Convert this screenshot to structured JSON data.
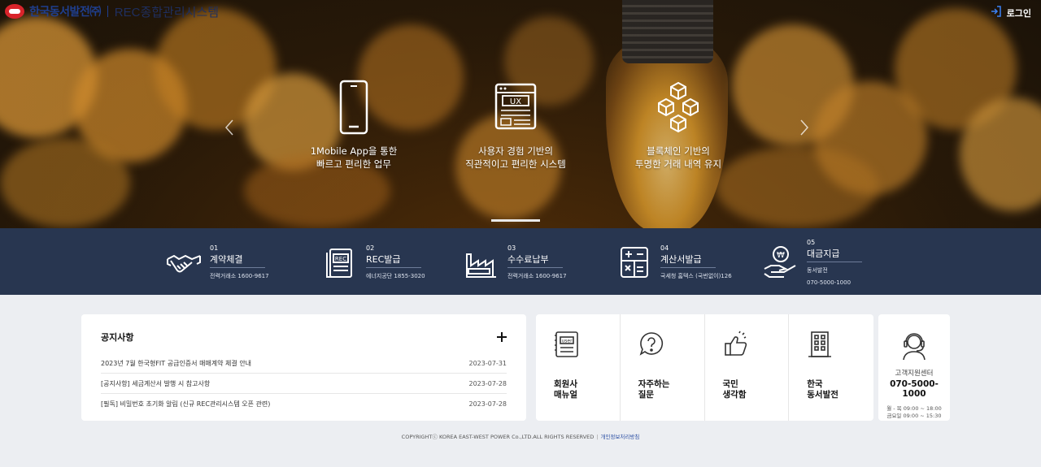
{
  "header": {
    "company": "한국동서발전㈜",
    "system": "REC종합관리시스템",
    "login_label": "로그인"
  },
  "hero": {
    "features": [
      {
        "icon": "smartphone-icon",
        "text": "1Mobile App을 통한\n빠르고 편리한 업무"
      },
      {
        "icon": "ux-document-icon",
        "text": "사용자 경험 기반의\n직관적이고 편리한 시스템"
      },
      {
        "icon": "blockchain-cubes-icon",
        "text": "블록체인 기반의\n투명한 거래 내역 유지"
      }
    ]
  },
  "services": [
    {
      "num": "01",
      "title": "계약체결",
      "sub": "전력거래소 1600-9617",
      "icon": "handshake-icon"
    },
    {
      "num": "02",
      "title": "REC발급",
      "sub": "에너지공단 1855-3020",
      "icon": "rec-document-icon"
    },
    {
      "num": "03",
      "title": "수수료납부",
      "sub": "전력거래소 1600-9617",
      "icon": "factory-icon"
    },
    {
      "num": "04",
      "title": "계산서발급",
      "sub": "국세청 홈텍스 (국번없이)126",
      "icon": "calculator-icon"
    },
    {
      "num": "05",
      "title": "대금지급",
      "sub": "동서발전",
      "sub2": "070-5000-1000",
      "icon": "won-hand-icon"
    }
  ],
  "notice": {
    "title": "공지사항",
    "items": [
      {
        "title": "2023년 7월 한국형FIT 공급인증서 매매계약 체결 안내",
        "date": "2023-07-31"
      },
      {
        "title": "[공지사항] 세금계산서 발행 시 참고사항",
        "date": "2023-07-28"
      },
      {
        "title": "[필독] 비밀번호 초기화 알림 (신규 REC관리시스템 오픈 관련)",
        "date": "2023-07-28"
      }
    ]
  },
  "quick_links": [
    {
      "label": "회원사\n매뉴얼",
      "icon": "user-manual-icon"
    },
    {
      "label": "자주하는\n질문",
      "icon": "question-bubble-icon"
    },
    {
      "label": "국민\n생각함",
      "icon": "thumbs-up-icon"
    },
    {
      "label": "한국\n동서발전",
      "icon": "building-icon"
    }
  ],
  "support": {
    "title": "고객지원센터",
    "phone": "070-5000-1000",
    "hours_weekday": "월 - 목 09:00 ~ 18:00",
    "hours_friday": "금요일 09:00 ~ 15:30",
    "icon": "headset-agent-icon"
  },
  "footer": {
    "copyright": "COPYRIGHTⓒ KOREA EAST-WEST POWER Co.,LTD.ALL RIGHTS RESERVED",
    "privacy": "개인정보처리방침"
  },
  "colors": {
    "service_bar": "#283650",
    "brand_blue": "#1f3f8f",
    "page_bg": "#eceef2"
  }
}
